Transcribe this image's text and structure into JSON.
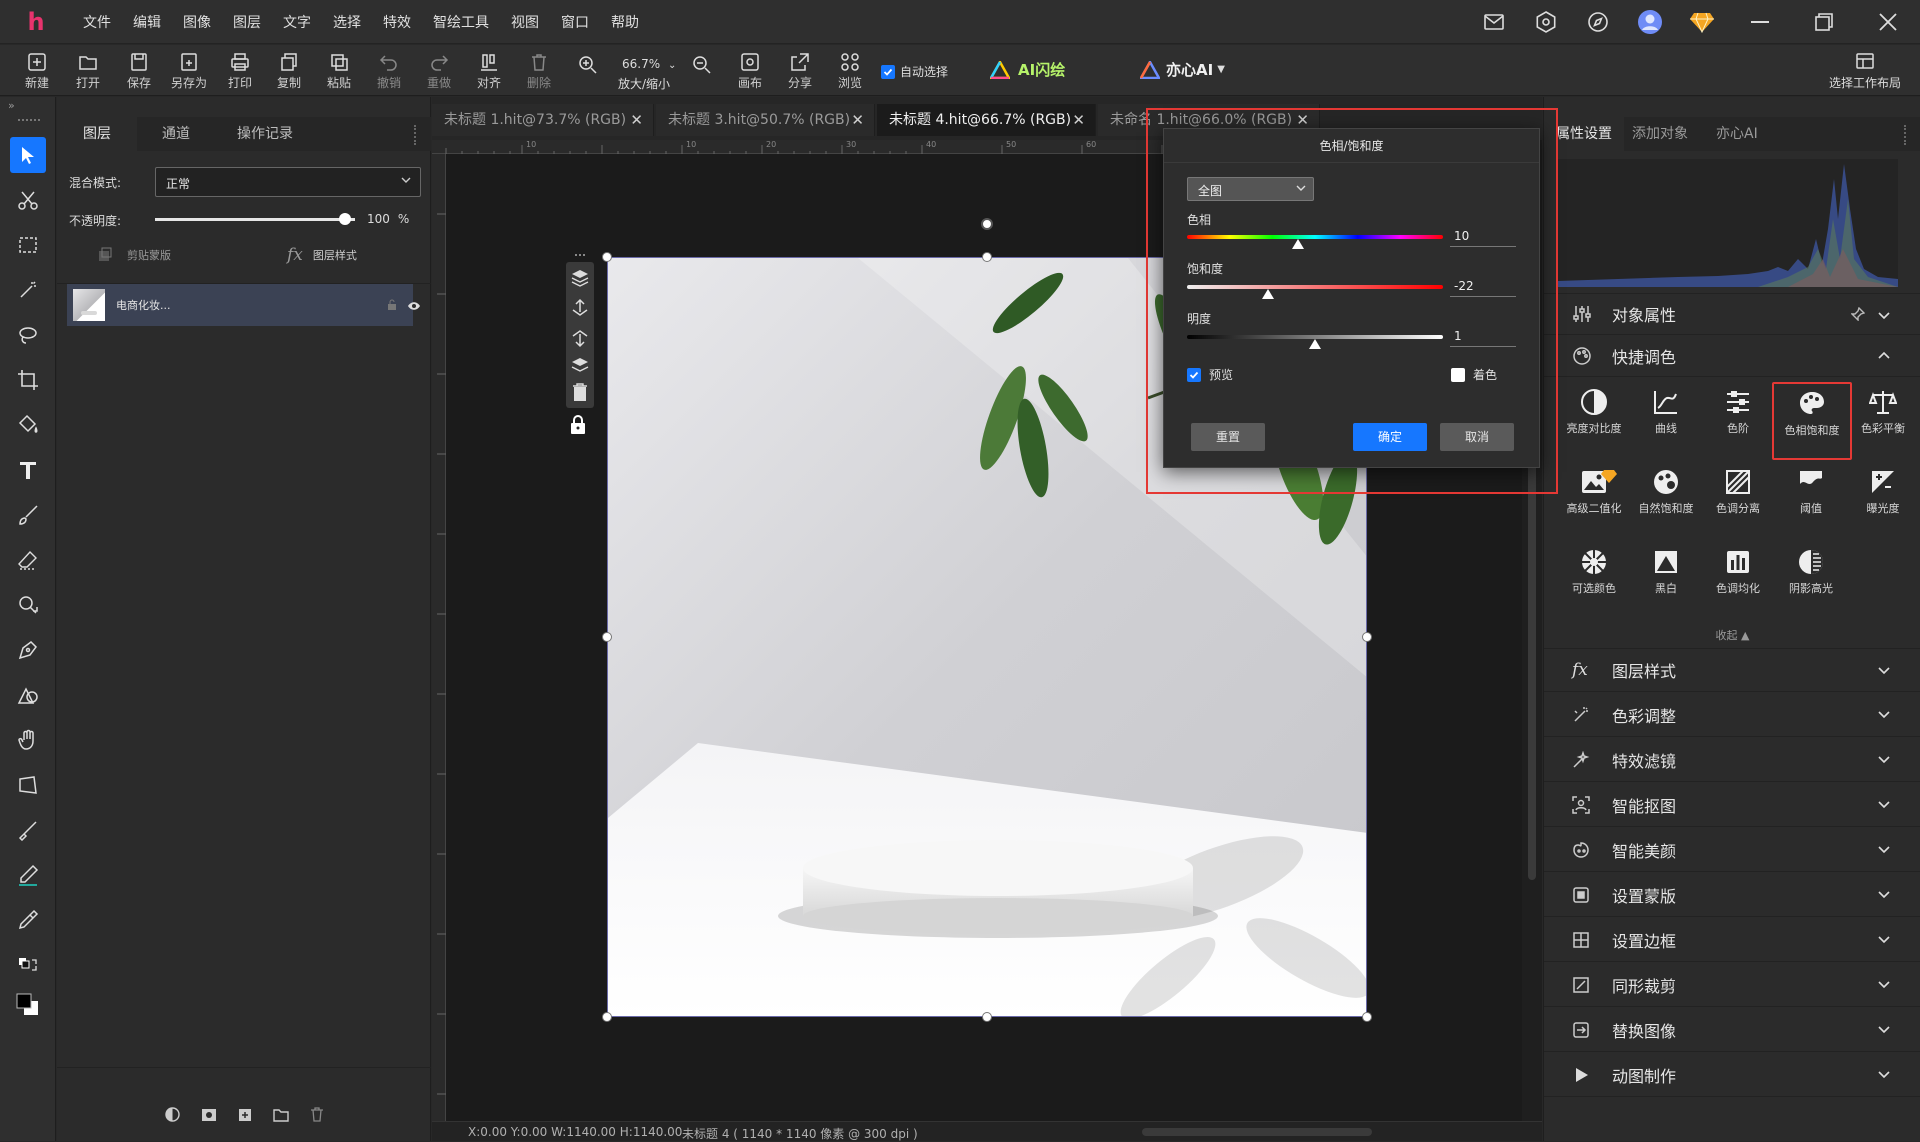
{
  "app": {
    "logo": "h"
  },
  "menu": [
    "文件",
    "编辑",
    "图像",
    "图层",
    "文字",
    "选择",
    "特效",
    "智绘工具",
    "视图",
    "窗口",
    "帮助"
  ],
  "toolbar": {
    "new": "新建",
    "open": "打开",
    "save": "保存",
    "save_as": "另存为",
    "print": "打印",
    "copy": "复制",
    "paste": "粘贴",
    "undo": "撤销",
    "redo": "重做",
    "align": "对齐",
    "delete": "删除",
    "zoom_value": "66.7%",
    "zoom_label": "放大/缩小",
    "canvas": "画布",
    "share": "分享",
    "browse": "浏览",
    "auto_select": "自动选择",
    "ai_flash": "AI闪绘",
    "yixin_ai": "亦心AI",
    "workspace": "选择工作布局"
  },
  "layers_panel": {
    "tabs": [
      "图层",
      "通道",
      "操作记录"
    ],
    "blend_label": "混合模式:",
    "blend_value": "正常",
    "opacity_label": "不透明度:",
    "opacity_value": "100",
    "opacity_unit": "%",
    "opacity_fraction": 1.0,
    "clip_mask": "剪贴蒙版",
    "layer_style": "图层样式",
    "layer_name": "电商化妆..."
  },
  "doc_tabs": [
    {
      "label": "未标题 1.hit@73.7% (RGB)",
      "active": false
    },
    {
      "label": "未标题 3.hit@50.7% (RGB)",
      "active": false
    },
    {
      "label": "未标题 4.hit@66.7% (RGB)",
      "active": true
    },
    {
      "label": "未命名 1.hit@66.0% (RGB)",
      "active": false
    }
  ],
  "ruler_top": [
    "10",
    "10",
    "20",
    "30",
    "40",
    "50",
    "60"
  ],
  "status_bar": {
    "coords": "X:0.00 Y:0.00 W:1140.00 H:1140.00",
    "doc_info": "未标题 4 ( 1140 * 1140 像素 @ 300 dpi )"
  },
  "dialog": {
    "title": "色相/饱和度",
    "range_select": "全图",
    "hue_label": "色相",
    "hue_value": "10",
    "sat_label": "饱和度",
    "sat_value": "-22",
    "light_label": "明度",
    "light_value": "1",
    "preview_label": "预览",
    "preview_checked": true,
    "colorize_label": "着色",
    "colorize_checked": false,
    "reset": "重置",
    "ok": "确定",
    "cancel": "取消",
    "highlight_color": "#e53935"
  },
  "right_panel": {
    "tabs": [
      "属性设置",
      "添加对象",
      "亦心AI"
    ],
    "object_props": "对象属性",
    "quick_color": "快捷调色",
    "quick_items": [
      {
        "label": "亮度对比度",
        "icon": "contrast-icon"
      },
      {
        "label": "曲线",
        "icon": "curve-icon"
      },
      {
        "label": "色阶",
        "icon": "levels-icon"
      },
      {
        "label": "色相饱和度",
        "icon": "palette-icon",
        "selected": true
      },
      {
        "label": "色彩平衡",
        "icon": "balance-icon"
      },
      {
        "label": "高级二值化",
        "icon": "image-binarize-icon",
        "premium": true
      },
      {
        "label": "自然饱和度",
        "icon": "vibrance-icon"
      },
      {
        "label": "色调分离",
        "icon": "posterize-icon"
      },
      {
        "label": "阈值",
        "icon": "threshold-icon"
      },
      {
        "label": "曝光度",
        "icon": "exposure-icon"
      },
      {
        "label": "可选颜色",
        "icon": "selective-color-icon"
      },
      {
        "label": "黑白",
        "icon": "black-white-icon"
      },
      {
        "label": "色调均化",
        "icon": "equalize-icon"
      },
      {
        "label": "阴影高光",
        "icon": "shadow-highlight-icon"
      }
    ],
    "collapse": "收起 ▲",
    "sections": [
      "图层样式",
      "色彩调整",
      "特效滤镜",
      "智能抠图",
      "智能美颜",
      "设置蒙版",
      "设置边框",
      "同形裁剪",
      "替换图像",
      "动图制作"
    ]
  },
  "colors": {
    "accent_blue": "#1677ff",
    "highlight_red": "#e53935",
    "premium_gold": "#f5a623"
  }
}
